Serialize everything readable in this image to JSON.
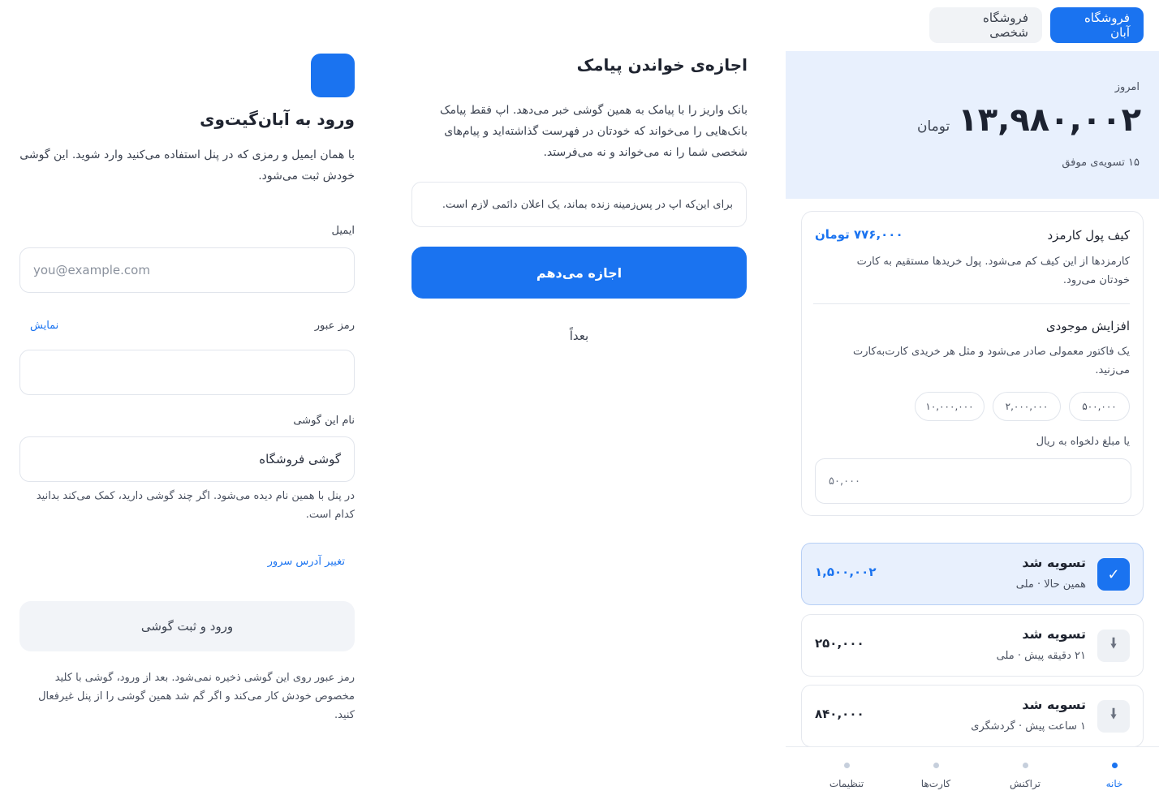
{
  "store_tabs": {
    "active": "فروشگاه آبان",
    "inactive": "فروشگاه شخصی"
  },
  "summary": {
    "label": "امروز",
    "amount": "۱۳,۹۸۰,۰۰۲",
    "currency": "تومان",
    "count_text": "۱۵ تسویه‌ی موفق"
  },
  "wallet": {
    "title": "کیف پول کارمزد",
    "balance": "۷۷۶,۰۰۰ تومان",
    "description": "کارمزدها از این کیف کم می‌شود. پول خریدها مستقیم به کارت خودتان می‌رود.",
    "topup_title": "افزایش موجودی",
    "topup_description": "یک فاکتور معمولی صادر می‌شود و مثل هر خریدی کارت‌به‌کارت می‌زنید.",
    "presets": [
      "۵۰۰,۰۰۰",
      "۲,۰۰۰,۰۰۰",
      "۱۰,۰۰۰,۰۰۰"
    ],
    "custom_label": "یا مبلغ دلخواه به ریال",
    "custom_placeholder": "۵۰,۰۰۰"
  },
  "transactions": [
    {
      "title": "تسویه شد",
      "subtitle": "همین حالا · ملی",
      "amount": "۱,۵۰۰,۰۰۲",
      "icon": "check-icon"
    },
    {
      "title": "تسویه شد",
      "subtitle": "۲۱ دقیقه پیش · ملی",
      "amount": "۲۵۰,۰۰۰",
      "icon": "download-icon"
    },
    {
      "title": "تسویه شد",
      "subtitle": "۱ ساعت پیش · گردشگری",
      "amount": "۸۴۰,۰۰۰",
      "icon": "download-icon"
    }
  ],
  "nav": [
    "خانه",
    "تراکنش",
    "کارت‌ها",
    "تنظیمات"
  ],
  "sms_permission": {
    "title": "اجازه‌ی خواندن پیامک",
    "description": "بانک واریز را با پیامک به همین گوشی خبر می‌دهد. اپ فقط پیامک بانک‌هایی را می‌خواند که خودتان در فهرست گذاشته‌اید و پیام‌های شخصی شما را نه می‌خواند و نه می‌فرستد.",
    "note": "برای این‌که اپ در پس‌زمینه زنده بماند، یک اعلان دائمی لازم است.",
    "allow_button": "اجازه می‌دهم",
    "later_button": "بعداً"
  },
  "login": {
    "title": "ورود به آبان‌گیت‌وی",
    "description": "با همان ایمیل و رمزی که در پنل استفاده می‌کنید وارد شوید. این گوشی خودش ثبت می‌شود.",
    "email_label": "ایمیل",
    "email_placeholder": "you@example.com",
    "password_label": "رمز عبور",
    "show_password": "نمایش",
    "device_label": "نام این گوشی",
    "device_value": "گوشی فروشگاه",
    "device_hint": "در پنل با همین نام دیده می‌شود. اگر چند گوشی دارید، کمک می‌کند بدانید کدام است.",
    "server_link": "تغییر آدرس سرور",
    "submit": "ورود و ثبت گوشی",
    "footnote": "رمز عبور روی این گوشی ذخیره نمی‌شود. بعد از ورود، گوشی با کلید مخصوص خودش کار می‌کند و اگر گم شد همین گوشی را از پنل غیرفعال کنید."
  },
  "colors": {
    "accent": "#1a73f0",
    "hero_bg": "#e8f0fd"
  }
}
